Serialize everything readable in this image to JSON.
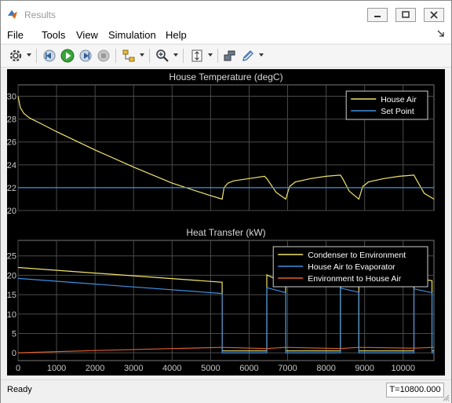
{
  "window": {
    "title": "Results",
    "minimize_icon": "minimize-icon",
    "restore_icon": "restore-icon",
    "close_icon": "close-icon"
  },
  "menu": {
    "items": [
      "File",
      "Tools",
      "View",
      "Simulation",
      "Help"
    ]
  },
  "toolbar": {
    "icons": [
      "settings-icon",
      "step-back-icon",
      "run-icon",
      "step-forward-icon",
      "stop-icon",
      "signal-icon",
      "zoom-icon",
      "fit-icon",
      "config-icon",
      "highlight-icon"
    ]
  },
  "status": {
    "text": "Ready",
    "time": "T=10800.000"
  },
  "colors": {
    "yellow": "#f2e36b",
    "blue": "#3d8fe0",
    "orange": "#e0602a",
    "grid": "#4a4a4a",
    "axis_bg": "#000000",
    "tick_text": "#c8c8c8"
  },
  "chart_data": [
    {
      "type": "line",
      "title": "House Temperature (degC)",
      "xlim": [
        0,
        10800
      ],
      "ylim": [
        20,
        31
      ],
      "yticks": [
        20,
        22,
        24,
        26,
        28,
        30
      ],
      "xticks": [
        0,
        1000,
        2000,
        3000,
        4000,
        5000,
        6000,
        7000,
        8000,
        9000,
        10000
      ],
      "show_xtick_labels": false,
      "grid": true,
      "legend": "top-right",
      "series": [
        {
          "name": "House Air",
          "color": "#f2e36b",
          "x": [
            0,
            60,
            150,
            300,
            600,
            1000,
            2000,
            3000,
            4000,
            5000,
            5200,
            5300,
            5350,
            5450,
            5600,
            6000,
            6400,
            6460,
            6700,
            6950,
            7050,
            7200,
            7600,
            8000,
            8370,
            8430,
            8600,
            8850,
            8950,
            9100,
            9500,
            9900,
            10280,
            10330,
            10550,
            10800
          ],
          "y": [
            30.0,
            29.0,
            28.5,
            28.1,
            27.6,
            26.9,
            25.3,
            23.8,
            22.4,
            21.3,
            21.1,
            21.0,
            22.0,
            22.4,
            22.6,
            22.8,
            23.0,
            22.8,
            21.6,
            21.0,
            22.1,
            22.5,
            22.8,
            23.0,
            23.1,
            22.8,
            21.7,
            21.0,
            22.1,
            22.5,
            22.8,
            23.0,
            23.1,
            22.8,
            21.5,
            21.0
          ]
        },
        {
          "name": "Set Point",
          "color": "#3d8fe0",
          "x": [
            0,
            10800
          ],
          "y": [
            22,
            22
          ]
        }
      ]
    },
    {
      "type": "line",
      "title": "Heat Transfer (kW)",
      "xlim": [
        0,
        10800
      ],
      "ylim": [
        -2,
        29
      ],
      "yticks": [
        0,
        5,
        10,
        15,
        20,
        25
      ],
      "xticks": [
        0,
        1000,
        2000,
        3000,
        4000,
        5000,
        6000,
        7000,
        8000,
        9000,
        10000
      ],
      "show_xtick_labels": true,
      "grid": true,
      "legend": "top-right",
      "series": [
        {
          "name": "Condenser to Environment",
          "color": "#f2e36b",
          "x": [
            0,
            5300,
            5300,
            6460,
            6460,
            6700,
            6950,
            6950,
            8370,
            8370,
            8850,
            8850,
            10280,
            10280,
            10750,
            10750,
            10800
          ],
          "y": [
            22.0,
            18.2,
            0.5,
            0.5,
            20.1,
            19.0,
            18.6,
            0.5,
            0.5,
            20.2,
            18.6,
            0.5,
            0.5,
            19.3,
            18.6,
            0.5,
            0.5
          ]
        },
        {
          "name": "House Air to Evaporator",
          "color": "#3d8fe0",
          "x": [
            0,
            5300,
            5300,
            6460,
            6460,
            6950,
            6950,
            8370,
            8370,
            8850,
            8850,
            10280,
            10280,
            10750,
            10750,
            10800
          ],
          "y": [
            19.2,
            15.3,
            0.0,
            0.0,
            16.8,
            15.5,
            0.0,
            0.0,
            16.7,
            15.6,
            0.0,
            0.0,
            16.5,
            15.5,
            0.0,
            0.0
          ]
        },
        {
          "name": "Environment to House Air",
          "color": "#e0602a",
          "x": [
            0,
            2000,
            4000,
            5300,
            6460,
            6950,
            8370,
            8850,
            10280,
            10800
          ],
          "y": [
            0.0,
            0.6,
            1.1,
            1.4,
            1.1,
            1.4,
            1.1,
            1.4,
            1.2,
            1.4
          ]
        }
      ]
    }
  ]
}
